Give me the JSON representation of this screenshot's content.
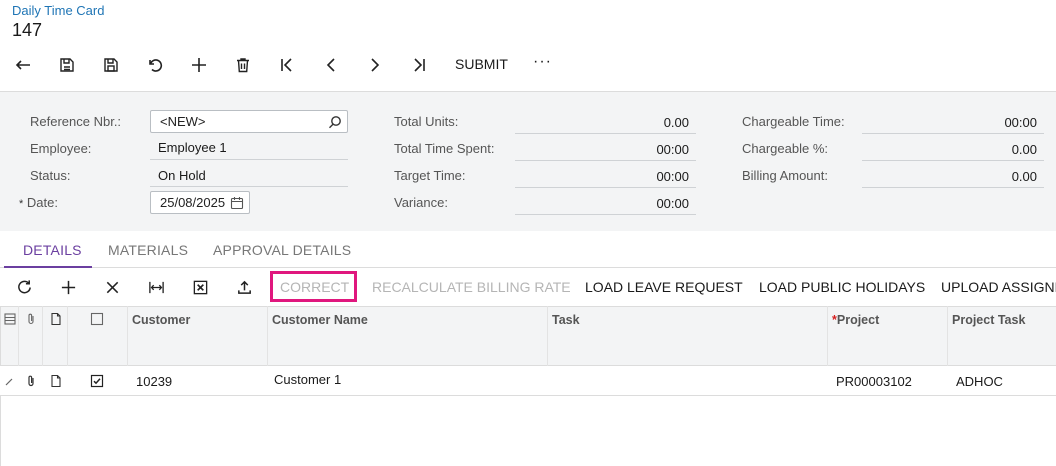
{
  "header": {
    "breadcrumb": "Daily Time Card",
    "title": "147"
  },
  "toolbar": {
    "icons": [
      "back-arrow-icon",
      "save-close-icon",
      "save-icon",
      "undo-icon",
      "add-icon",
      "delete-icon",
      "first-record-icon",
      "previous-record-icon",
      "next-record-icon",
      "last-record-icon"
    ],
    "submit_label": "SUBMIT",
    "more_label": "···"
  },
  "form": {
    "reference_nbr": {
      "label": "Reference Nbr.:",
      "value": "<NEW>"
    },
    "employee": {
      "label": "Employee:",
      "value": "Employee 1"
    },
    "status": {
      "label": "Status:",
      "value": "On Hold"
    },
    "date": {
      "required_mark": "*",
      "label": "Date:",
      "value": "25/08/2025"
    },
    "total_units": {
      "label": "Total Units:",
      "value": "0.00"
    },
    "total_time_spent": {
      "label": "Total Time Spent:",
      "value": "00:00"
    },
    "target_time": {
      "label": "Target Time:",
      "value": "00:00"
    },
    "variance": {
      "label": "Variance:",
      "value": "00:00"
    },
    "chargeable_time": {
      "label": "Chargeable Time:",
      "value": "00:00"
    },
    "chargeable_pct": {
      "label": "Chargeable %:",
      "value": "0.00"
    },
    "billing_amount": {
      "label": "Billing Amount:",
      "value": "0.00"
    }
  },
  "tabs": [
    {
      "label": "DETAILS",
      "active": true
    },
    {
      "label": "MATERIALS",
      "active": false
    },
    {
      "label": "APPROVAL DETAILS",
      "active": false
    }
  ],
  "grid_toolbar": {
    "icons": [
      "refresh-icon",
      "add-row-icon",
      "delete-row-icon",
      "fit-columns-icon",
      "export-excel-icon",
      "upload-icon"
    ],
    "buttons": [
      {
        "label": "CORRECT",
        "enabled": false,
        "highlighted": true
      },
      {
        "label": "RECALCULATE BILLING RATE",
        "enabled": false
      },
      {
        "label": "LOAD LEAVE REQUEST",
        "enabled": true
      },
      {
        "label": "LOAD PUBLIC HOLIDAYS",
        "enabled": true
      },
      {
        "label": "UPLOAD ASSIGNM",
        "enabled": true
      }
    ],
    "highlight_color": "#e0177e"
  },
  "grid": {
    "columns": [
      "Customer",
      "Customer Name",
      "Task",
      "Project",
      "Project Task"
    ],
    "project_required_mark": "*",
    "rows": [
      {
        "checked": true,
        "customer": "10239",
        "customer_name": "Customer 1",
        "task": "",
        "project": "PR00003102",
        "project_task": "ADHOC"
      }
    ]
  },
  "colors": {
    "link": "#1f75b5",
    "accent": "#6b3fa0",
    "required": "#d62020"
  }
}
